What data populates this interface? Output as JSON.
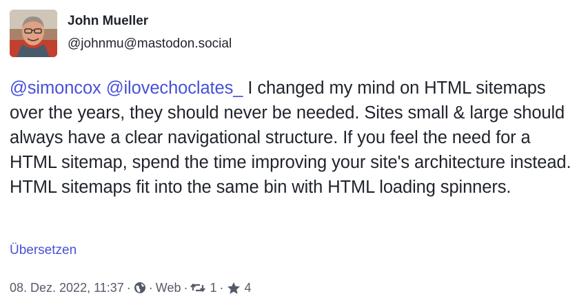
{
  "author": {
    "display_name": "John Mueller",
    "account": "@johnmu@mastodon.social"
  },
  "content": {
    "mentions": [
      "@simoncox",
      "@ilovechoclates_"
    ],
    "text": "I changed my mind on HTML sitemaps over the years, they should never be needed. Sites small & large should always have a clear navigational structure. If you feel the need for a HTML sitemap, spend the time improving your site's architecture instead. HTML sitemaps fit into the same bin with HTML loading spinners."
  },
  "translate_label": "Übersetzen",
  "meta": {
    "timestamp": "08. Dez. 2022, 11:37",
    "separator": "·",
    "visibility_icon": "globe-icon",
    "application": "Web",
    "boost_icon": "boost-icon",
    "boost_count": "1",
    "favourite_icon": "star-icon",
    "favourite_count": "4"
  },
  "colors": {
    "link": "#4651d6",
    "text": "#1f232b",
    "meta": "#545a68",
    "background": "#ffffff"
  }
}
